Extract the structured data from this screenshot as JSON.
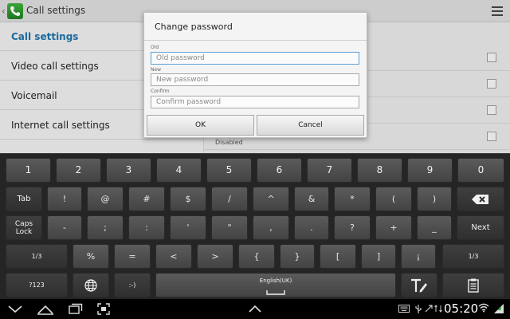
{
  "titlebar": {
    "title": "Call settings",
    "app_icon": "phone-icon",
    "menu_icon": "menu-icon"
  },
  "left_pane": {
    "items": [
      {
        "label": "Call settings",
        "active": true
      },
      {
        "label": "Video call settings",
        "active": false
      },
      {
        "label": "Voicemail",
        "active": false
      },
      {
        "label": "Internet call settings",
        "active": false
      }
    ]
  },
  "right_pane": {
    "disabled_text": "Disabled"
  },
  "dialog": {
    "title": "Change password",
    "fields": [
      {
        "label": "Old",
        "placeholder": "Old password"
      },
      {
        "label": "New",
        "placeholder": "New password"
      },
      {
        "label": "Confirm",
        "placeholder": "Confirm password"
      }
    ],
    "ok_label": "OK",
    "cancel_label": "Cancel"
  },
  "keyboard": {
    "row1": [
      "1",
      "2",
      "3",
      "4",
      "5",
      "6",
      "7",
      "8",
      "9",
      "0"
    ],
    "row2": [
      "Tab",
      "!",
      "@",
      "#",
      "$",
      "/",
      "^",
      "&",
      "*",
      "(",
      ")",
      "backspace-icon"
    ],
    "row3": [
      "Caps",
      "Lock",
      "-",
      ";",
      ":",
      "'",
      "\"",
      ",",
      ".",
      "?",
      "+",
      "_",
      "Next"
    ],
    "row4": [
      "1/3",
      "%",
      "=",
      "<",
      ">",
      "{",
      "}",
      "[",
      "]",
      "¡",
      "1/3"
    ],
    "row5": {
      "sym": "?123",
      "language": "English(UK)",
      "emoticon": ":-)",
      "icons": [
        "globe-icon",
        "handwriting-icon",
        "clipboard-icon"
      ]
    }
  },
  "systembar": {
    "time": "05:20",
    "nav_icons": [
      "back-icon",
      "home-icon",
      "recent-apps-icon",
      "screenshot-icon",
      "keyboard-hide-icon"
    ],
    "status_icons": [
      "keyboard-icon",
      "usb-icon",
      "sync-icon",
      "wifi-icon",
      "battery-icon"
    ]
  }
}
